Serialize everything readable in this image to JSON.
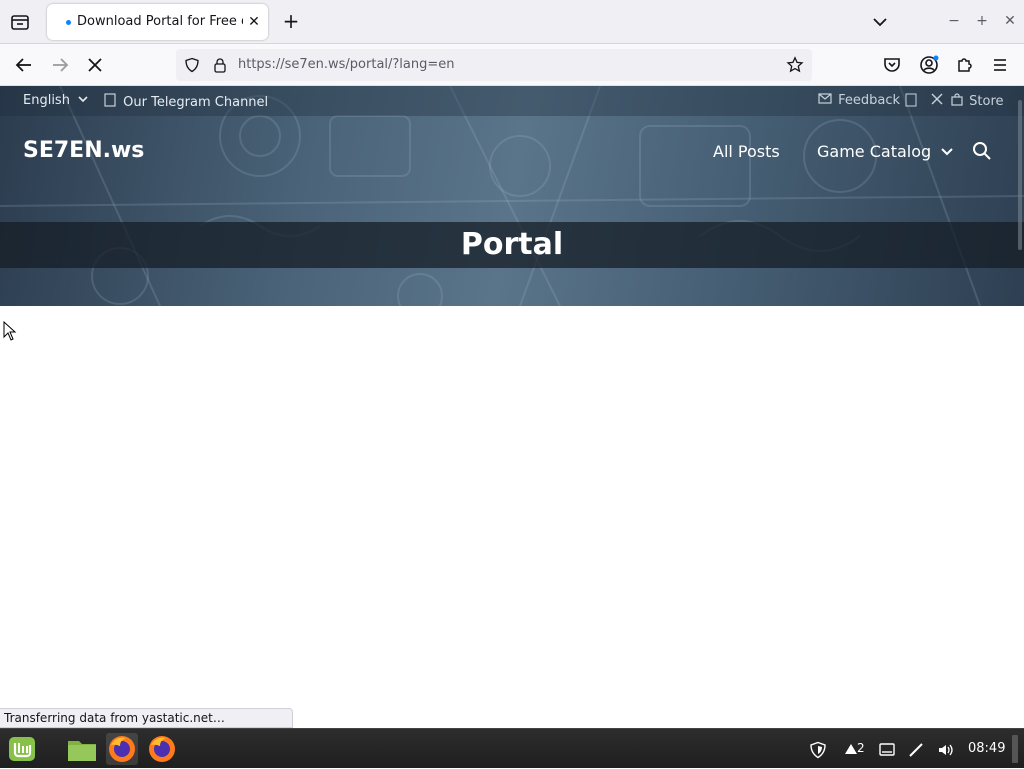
{
  "browser": {
    "tab_title": "Download Portal for Free on",
    "url": "https://se7en.ws/portal/?lang=en",
    "status_text": "Transferring data from yastatic.net…"
  },
  "site": {
    "topbar": {
      "language": "English",
      "telegram": "Our Telegram Channel",
      "feedback": "Feedback",
      "store": "Store"
    },
    "brand": "SE7EN.ws",
    "menu": {
      "all_posts": "All Posts",
      "game_catalog": "Game Catalog"
    },
    "page_title": "Portal"
  },
  "taskbar": {
    "notification_count": "2",
    "clock": "08:49"
  },
  "colors": {
    "accent": "#0a84ff",
    "header_dark": "#2c3c4f",
    "header_mid": "#5a748a"
  },
  "icons": [
    "tab-list-icon",
    "close-icon",
    "plus-icon",
    "chevron-down-icon",
    "minimize-icon",
    "maximize-icon",
    "back-icon",
    "forward-icon",
    "stop-icon",
    "shield-icon",
    "lock-icon",
    "star-icon",
    "pocket-icon",
    "account-icon",
    "extensions-icon",
    "menu-icon",
    "search-icon",
    "mail-icon",
    "x-icon",
    "bag-icon"
  ]
}
